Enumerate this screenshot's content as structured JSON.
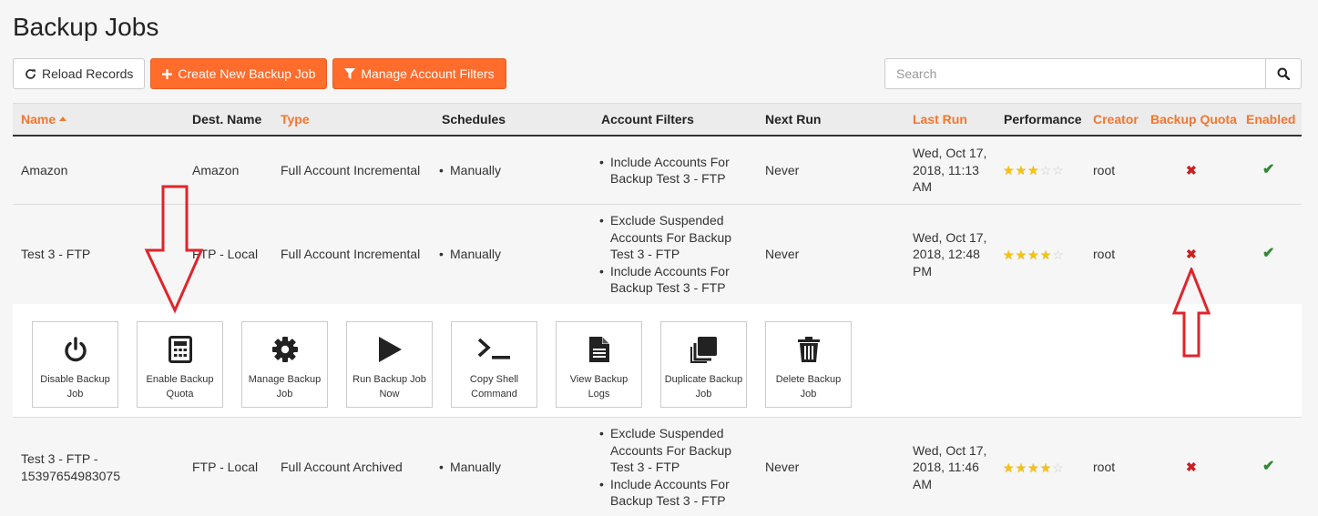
{
  "page": {
    "title": "Backup Jobs"
  },
  "toolbar": {
    "reload_label": "Reload Records",
    "create_label": "Create New Backup Job",
    "filters_label": "Manage Account Filters"
  },
  "search": {
    "placeholder": "Search"
  },
  "colors": {
    "accent": "#ff6c2c",
    "sort_header": "#f3762e",
    "star": "#f5c211",
    "disabled": "#cc1f1f",
    "enabled": "#2f8a2f"
  },
  "table": {
    "columns": {
      "name": "Name",
      "dest": "Dest. Name",
      "type": "Type",
      "schedules": "Schedules",
      "filters": "Account Filters",
      "next_run": "Next Run",
      "last_run": "Last Run",
      "performance": "Performance",
      "creator": "Creator",
      "quota": "Backup Quota",
      "enabled": "Enabled"
    },
    "rows": [
      {
        "name": "Amazon",
        "dest": "Amazon",
        "type": "Full Account Incremental",
        "schedule": "Manually",
        "filters": [
          "Include Accounts For Backup Test 3 - FTP"
        ],
        "next_run": "Never",
        "last_run": "Wed, Oct 17, 2018, 11:13 AM",
        "performance": 3,
        "creator": "root",
        "quota": "disabled",
        "enabled": true
      },
      {
        "name": "Test 3 - FTP",
        "dest": "FTP - Local",
        "type": "Full Account Incremental",
        "schedule": "Manually",
        "filters": [
          "Exclude Suspended Accounts For Backup Test 3 - FTP",
          "Include Accounts For Backup Test 3 - FTP"
        ],
        "next_run": "Never",
        "last_run": "Wed, Oct 17, 2018, 12:48 PM",
        "performance": 4,
        "creator": "root",
        "quota": "disabled",
        "enabled": true
      },
      {
        "name": "Test 3 - FTP - 15397654983075",
        "dest": "FTP - Local",
        "type": "Full Account Archived",
        "schedule": "Manually",
        "filters": [
          "Exclude Suspended Accounts For Backup Test 3 - FTP",
          "Include Accounts For Backup Test 3 - FTP"
        ],
        "next_run": "Never",
        "last_run": "Wed, Oct 17, 2018, 11:46 AM",
        "performance": 4,
        "creator": "root",
        "quota": "disabled",
        "enabled": true
      }
    ]
  },
  "actions": [
    {
      "label": "Disable Backup Job",
      "icon": "power-icon"
    },
    {
      "label": "Enable Backup Quota",
      "icon": "calculator-icon"
    },
    {
      "label": "Manage Backup Job",
      "icon": "gear-icon"
    },
    {
      "label": "Run Backup Job Now",
      "icon": "play-icon"
    },
    {
      "label": "Copy Shell Command",
      "icon": "terminal-icon"
    },
    {
      "label": "View Backup Logs",
      "icon": "file-text-icon"
    },
    {
      "label": "Duplicate Backup Job",
      "icon": "copy-icon"
    },
    {
      "label": "Delete Backup Job",
      "icon": "trash-icon"
    }
  ],
  "performance_max": 5
}
